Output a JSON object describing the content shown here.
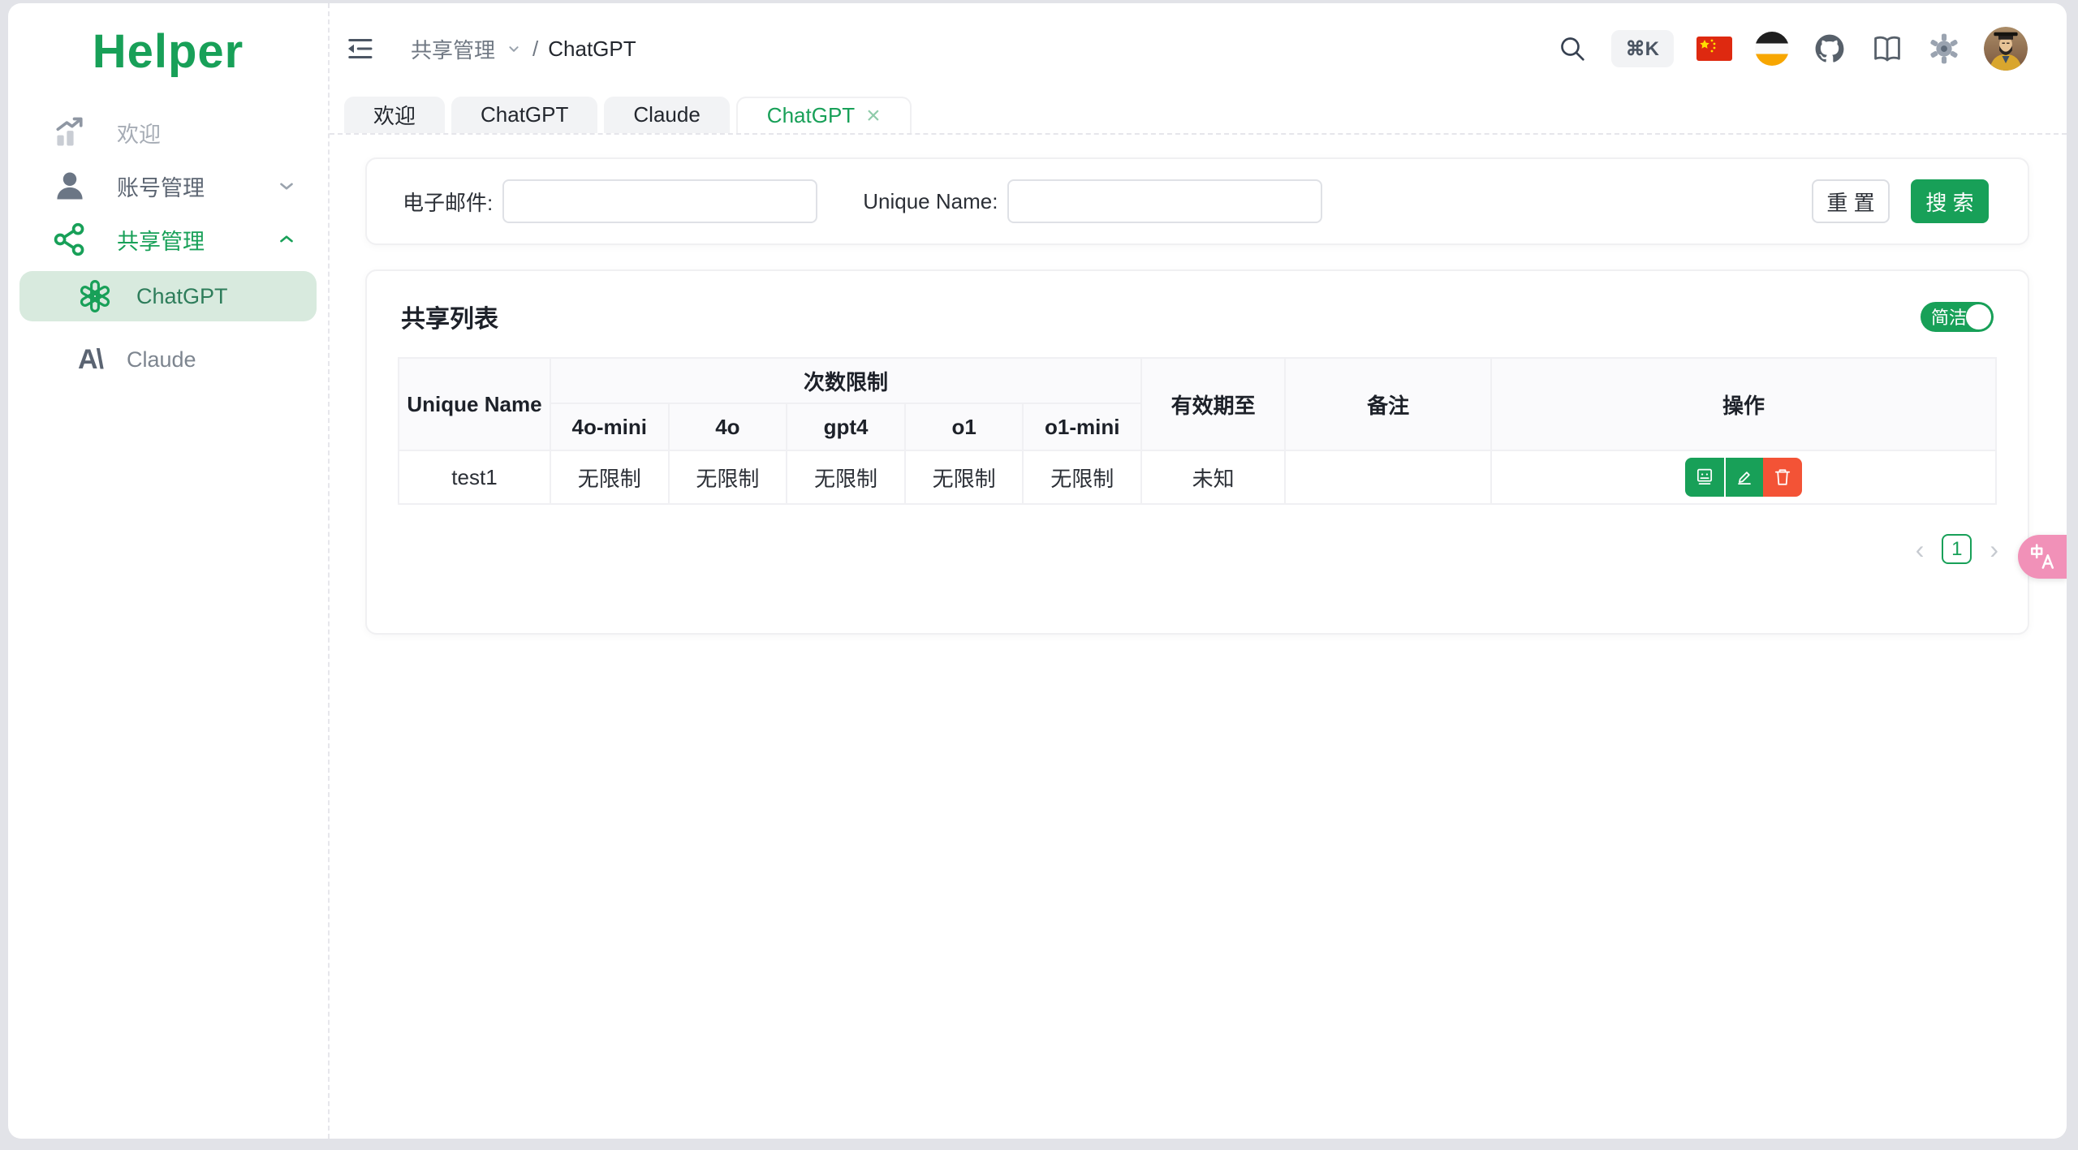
{
  "sidebar": {
    "logo": "Helper",
    "items": [
      {
        "label": "欢迎",
        "icon": "chart-icon"
      },
      {
        "label": "账号管理",
        "icon": "user-icon",
        "chevron": "down"
      },
      {
        "label": "共享管理",
        "icon": "share-icon",
        "chevron": "up"
      }
    ],
    "subitems": [
      {
        "label": "ChatGPT",
        "icon": "openai-icon",
        "active": true
      },
      {
        "label": "Claude",
        "icon": "anthropic-icon",
        "active": false
      }
    ]
  },
  "header": {
    "breadcrumb": {
      "section": "共享管理",
      "separator": "/",
      "page": "ChatGPT"
    },
    "shortcut_badge": "⌘K",
    "icons": [
      "search-icon",
      "keyboard-shortcut-badge",
      "flag-china-icon",
      "flag-stripes-icon",
      "github-icon",
      "docs-book-icon",
      "gear-icon",
      "user-avatar"
    ]
  },
  "tabs": [
    {
      "label": "欢迎",
      "active": false
    },
    {
      "label": "ChatGPT",
      "active": false
    },
    {
      "label": "Claude",
      "active": false
    },
    {
      "label": "ChatGPT",
      "active": true,
      "closable": true,
      "close_glyph": "×"
    }
  ],
  "search_form": {
    "email_label": "电子邮件:",
    "email_value": "",
    "unique_name_label": "Unique Name:",
    "unique_name_value": "",
    "reset_label": "重 置",
    "search_label": "搜 索"
  },
  "share_list": {
    "title": "共享列表",
    "toggle_label": "简洁",
    "toggle_state": "on",
    "table": {
      "columns": {
        "unique_name": "Unique Name",
        "limits_group": "次数限制",
        "models": [
          "4o-mini",
          "4o",
          "gpt4",
          "o1",
          "o1-mini"
        ],
        "expiry": "有效期至",
        "note": "备注",
        "actions": "操作"
      },
      "rows": [
        {
          "unique_name": "test1",
          "limits": [
            "无限制",
            "无限制",
            "无限制",
            "无限制",
            "无限制"
          ],
          "expiry": "未知",
          "note": "",
          "action_icons": [
            "id-card-icon",
            "edit-pencil-icon",
            "trash-icon"
          ]
        }
      ]
    },
    "pagination": {
      "prev": "‹",
      "current": "1",
      "next": "›"
    }
  },
  "colors": {
    "primary_green": "#18a058",
    "active_item_bg": "#d8eade",
    "active_item_text": "#2e7d5b",
    "danger_red": "#f35336",
    "translate_fab_pink": "#f191b8",
    "header_bg": "#fafafc",
    "border_light": "#f0f0f3"
  }
}
